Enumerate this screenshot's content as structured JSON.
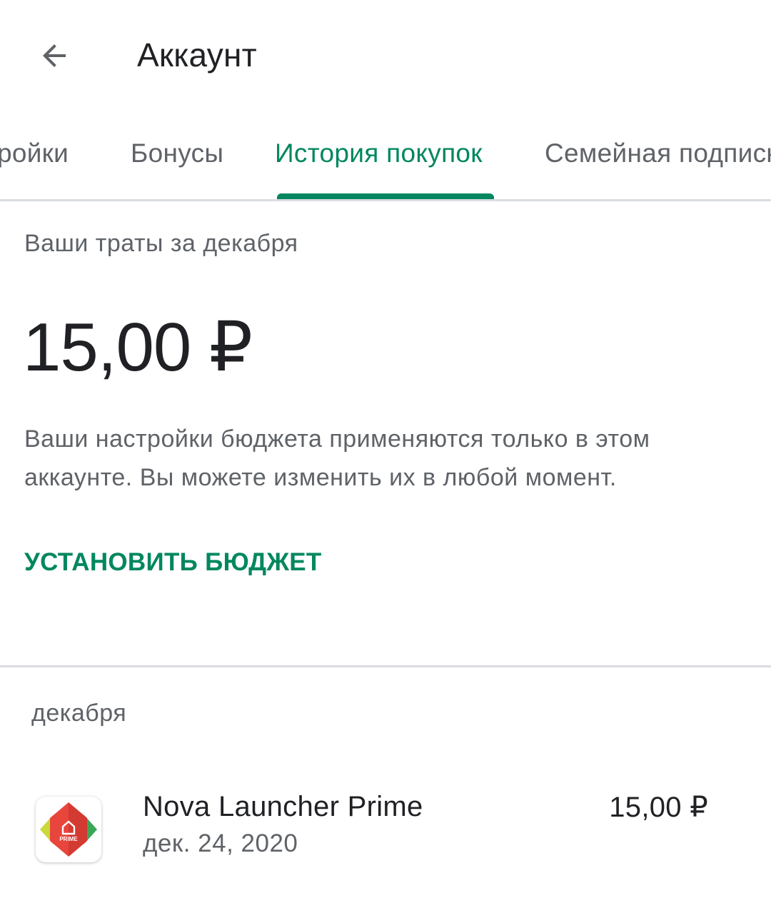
{
  "app_bar": {
    "title": "Аккаунт",
    "back_icon": "arrow-back-icon"
  },
  "tabs": [
    {
      "label": "Настройки",
      "active": false
    },
    {
      "label": "Бонусы",
      "active": false
    },
    {
      "label": "История покупок",
      "active": true
    },
    {
      "label": "Семейная подписка",
      "active": false
    }
  ],
  "spending": {
    "label": "Ваши траты за декабря",
    "amount": "15,00 ₽",
    "note": "Ваши настройки бюджета применяются только в этом аккаунте. Вы можете изменить их в любой момент.",
    "set_budget_label": "УСТАНОВИТЬ БЮДЖЕТ"
  },
  "history": {
    "month": "декабря",
    "items": [
      {
        "name": "Nova Launcher Prime",
        "date": "дек. 24, 2020",
        "price": "15,00 ₽",
        "icon": "nova-launcher-prime-icon",
        "icon_text": "PRIME"
      }
    ]
  },
  "colors": {
    "accent": "#01875f",
    "text_primary": "#202124",
    "text_secondary": "#5f6368",
    "divider": "#dadce0"
  }
}
